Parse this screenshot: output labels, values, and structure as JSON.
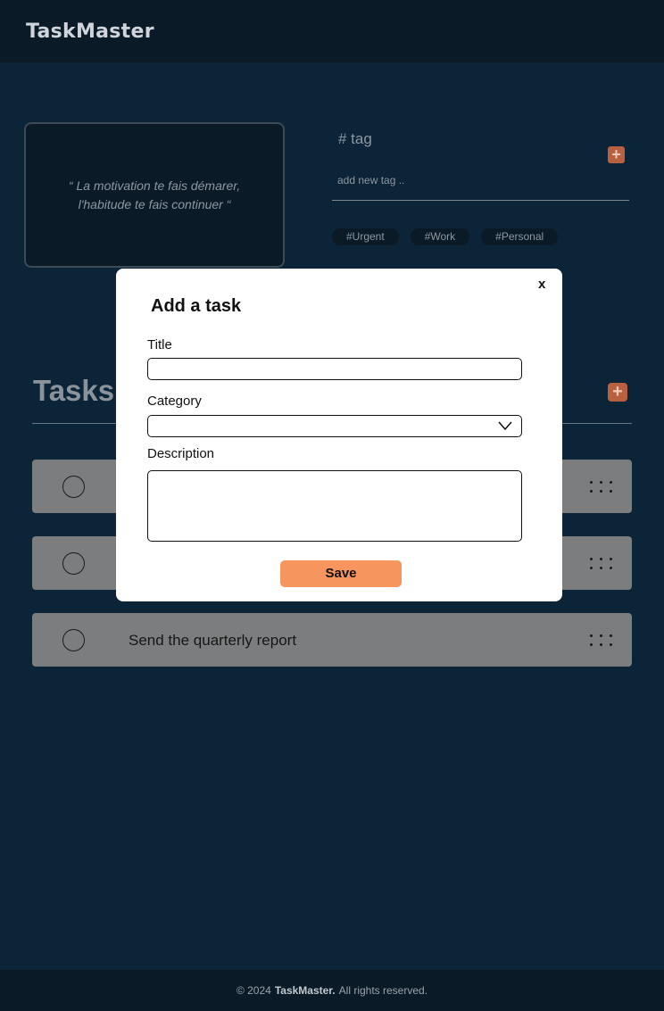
{
  "header": {
    "app_name": "TaskMaster"
  },
  "quote": {
    "text": "“ La motivation te fais démarer, l'habitude te fais continuer  “"
  },
  "tag_panel": {
    "title": "# tag",
    "add_icon": "+",
    "input_placeholder": "add new tag ..",
    "tags": [
      "#Urgent",
      "#Work",
      "#Personal"
    ]
  },
  "tasks": {
    "title": "Tasks",
    "add_icon": "+",
    "items": [
      {
        "title": ""
      },
      {
        "title": ""
      },
      {
        "title": "Send the quarterly report"
      }
    ]
  },
  "modal": {
    "close_label": "x",
    "title": "Add a task",
    "title_label": "Title",
    "title_value": "",
    "category_label": "Category",
    "category_value": "",
    "description_label": "Description",
    "description_value": "",
    "save_label": "Save"
  },
  "footer": {
    "copyright": "© 2024",
    "brand": "TaskMaster.",
    "rights": "All rights reserved."
  },
  "colors": {
    "background": "#0b2438",
    "header_bg": "#0b1a27",
    "accent": "#f7955f",
    "task_row": "#7c7d7e"
  }
}
